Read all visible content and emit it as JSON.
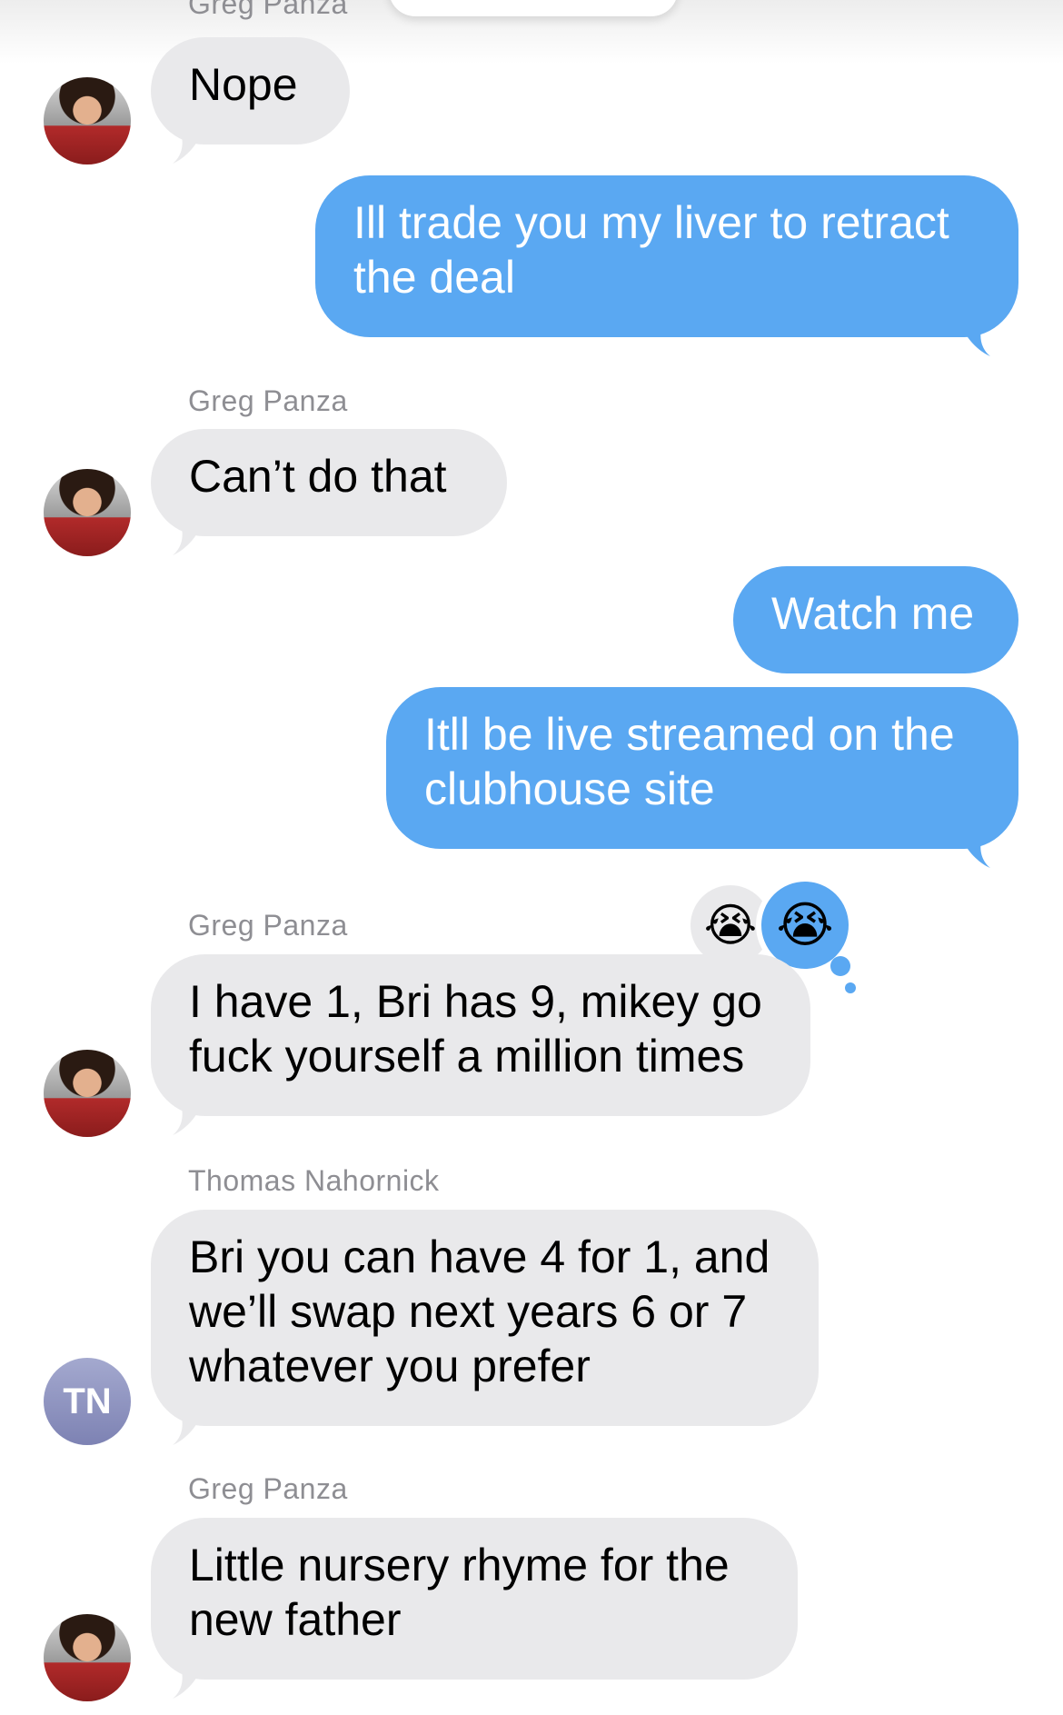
{
  "conversation": {
    "partial_top_sender": "Greg Panza",
    "messages": [
      {
        "id": "m1",
        "sender": "Greg Panza",
        "direction": "incoming",
        "text": "Nope",
        "avatar": "photo"
      },
      {
        "id": "m2",
        "sender": "Me",
        "direction": "outgoing",
        "text": "Ill trade you my liver to retract the deal"
      },
      {
        "id": "m3",
        "sender": "Greg Panza",
        "direction": "incoming",
        "text": "Can’t do that",
        "avatar": "photo"
      },
      {
        "id": "m4",
        "sender": "Me",
        "direction": "outgoing",
        "text": "Watch me"
      },
      {
        "id": "m5",
        "sender": "Me",
        "direction": "outgoing",
        "text": "Itll be live streamed on the clubhouse site"
      },
      {
        "id": "m6",
        "sender": "Greg Panza",
        "direction": "incoming",
        "text": "I have 1, Bri has 9, mikey go fuck yourself a million times",
        "avatar": "photo",
        "reactions": [
          "😭",
          "😭"
        ]
      },
      {
        "id": "m7",
        "sender": "Thomas Nahornick",
        "direction": "incoming",
        "text": "Bri you can have 4 for 1, and we’ll swap next years 6 or 7 whatever you prefer",
        "avatar": "initials",
        "initials": "TN"
      },
      {
        "id": "m8",
        "sender": "Greg Panza",
        "direction": "incoming",
        "text": "Little nursery rhyme for the new father",
        "avatar": "photo"
      }
    ]
  },
  "colors": {
    "outgoing": "#5aa8f2",
    "incoming": "#e9e9eb",
    "sender_label": "#8e8e93",
    "tn_avatar": "#8e93c2"
  },
  "icons": {
    "reaction": "loudly-crying-face-emoji"
  }
}
